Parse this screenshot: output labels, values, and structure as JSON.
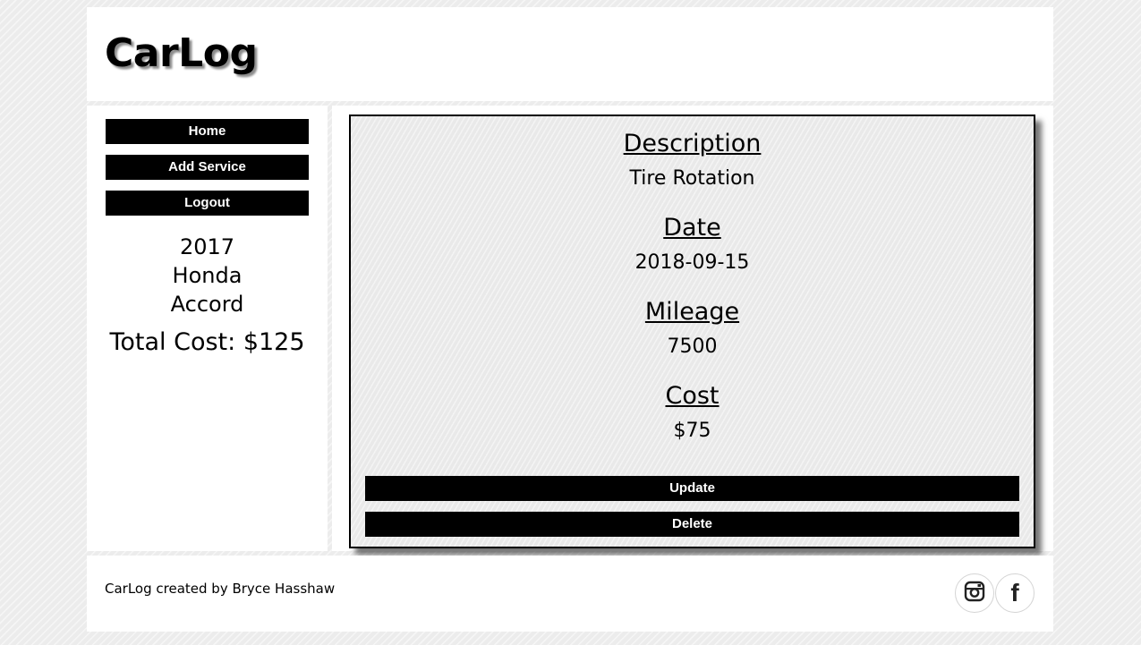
{
  "header": {
    "logo": "CarLog"
  },
  "sidebar": {
    "nav": [
      {
        "label": "Home"
      },
      {
        "label": "Add Service"
      },
      {
        "label": "Logout"
      }
    ],
    "car": {
      "year": "2017",
      "make": "Honda",
      "model": "Accord"
    },
    "total_cost": "Total Cost: $125"
  },
  "service": {
    "description_label": "Description",
    "description": "Tire Rotation",
    "date_label": "Date",
    "date": "2018-09-15",
    "mileage_label": "Mileage",
    "mileage": "7500",
    "cost_label": "Cost",
    "cost": "$75",
    "update_label": "Update",
    "delete_label": "Delete"
  },
  "footer": {
    "credit": "CarLog created by Bryce Hasshaw",
    "social": [
      {
        "icon": "instagram-icon"
      },
      {
        "icon": "facebook-icon"
      }
    ]
  },
  "colors": {
    "button_bg": "#000000",
    "button_text": "#ffffff",
    "panel_bg": "#ffffff",
    "page_bg": "#ececec"
  }
}
